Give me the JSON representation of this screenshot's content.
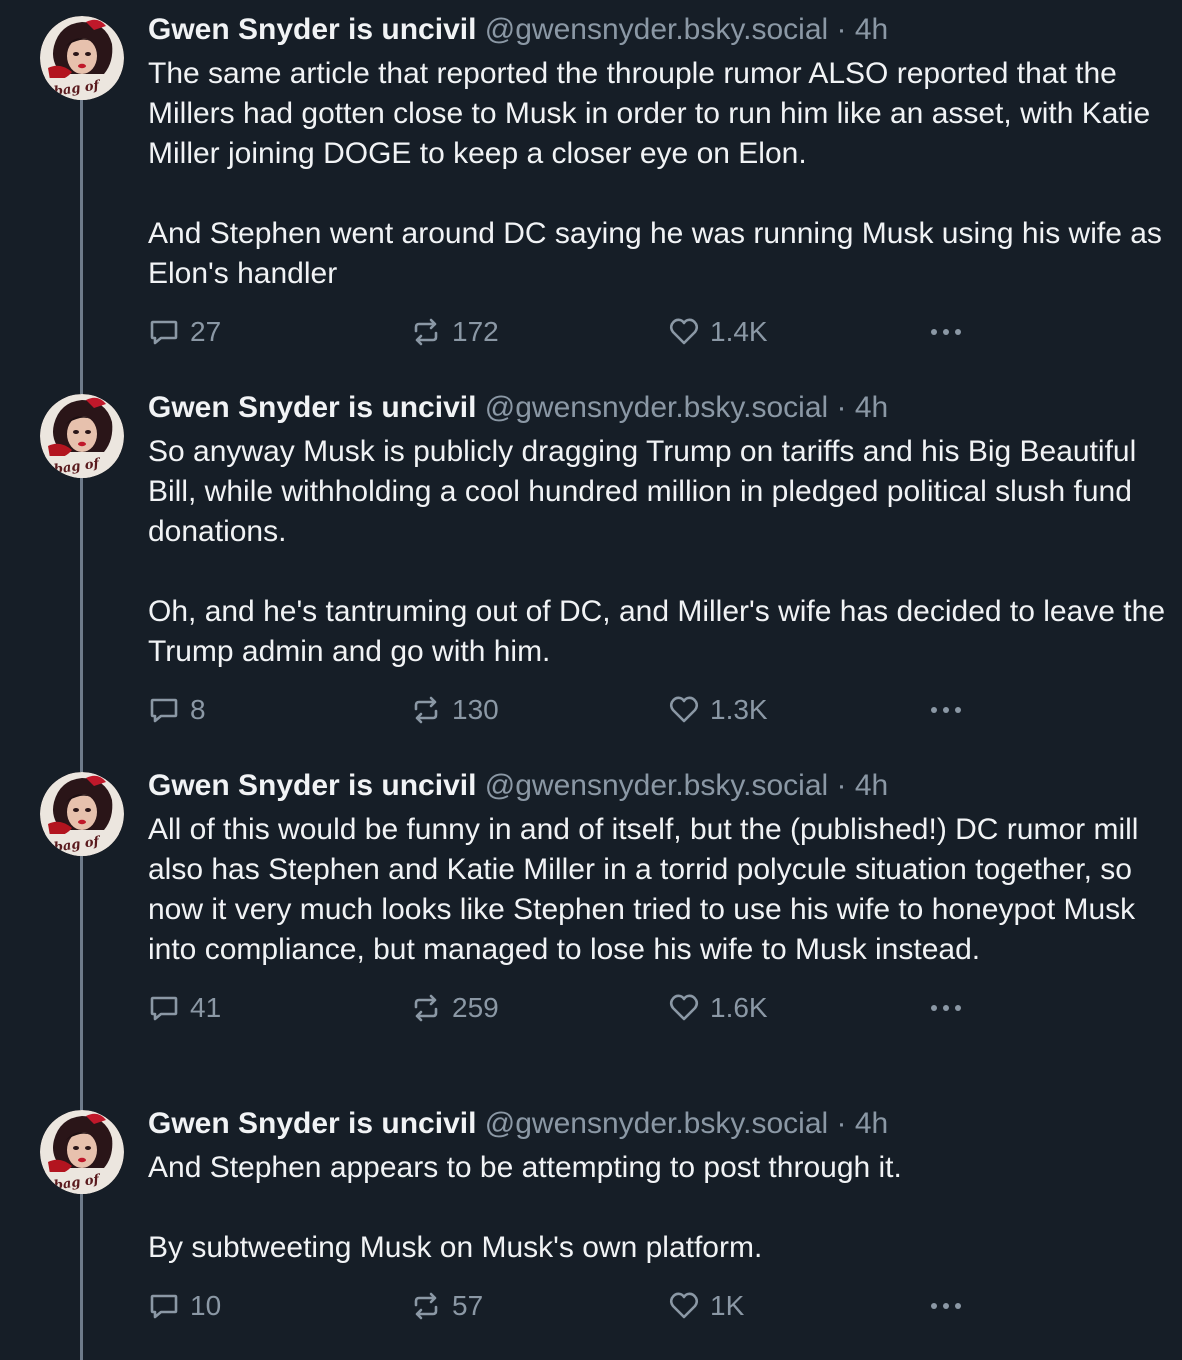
{
  "posts": [
    {
      "author": "Gwen Snyder is uncivil",
      "handle": "@gwensnyder.bsky.social",
      "separator": "·",
      "time": "4h",
      "avatar_text": "bag of",
      "paragraphs": [
        "The same article that reported the throuple rumor ALSO reported that the Millers had gotten close to Musk in order to run him like an asset, with Katie Miller joining DOGE to keep a closer eye on Elon.",
        "And Stephen went around DC saying he was running Musk using his wife as Elon's handler"
      ],
      "replies": "27",
      "reposts": "172",
      "likes": "1.4K"
    },
    {
      "author": "Gwen Snyder is uncivil",
      "handle": "@gwensnyder.bsky.social",
      "separator": "·",
      "time": "4h",
      "avatar_text": "bag of",
      "paragraphs": [
        "So anyway Musk is publicly dragging Trump on tariffs and his Big Beautiful Bill, while withholding a cool hundred million in pledged political slush fund donations.",
        "Oh, and he's tantruming out of DC, and Miller's wife has decided to leave the Trump admin and go with him."
      ],
      "replies": "8",
      "reposts": "130",
      "likes": "1.3K"
    },
    {
      "author": "Gwen Snyder is uncivil",
      "handle": "@gwensnyder.bsky.social",
      "separator": "·",
      "time": "4h",
      "avatar_text": "bag of",
      "paragraphs": [
        "All of this would be funny in and of itself, but the (published!) DC rumor mill also has Stephen and Katie Miller in a torrid polycule situation together, so now it very much looks like Stephen tried to use his wife to honeypot Musk into compliance, but managed to lose his wife to Musk instead."
      ],
      "replies": "41",
      "reposts": "259",
      "likes": "1.6K"
    },
    {
      "author": "Gwen Snyder is uncivil",
      "handle": "@gwensnyder.bsky.social",
      "separator": "·",
      "time": "4h",
      "avatar_text": "bag of",
      "paragraphs": [
        "And Stephen appears to be attempting to post through it.",
        "By subtweeting Musk on Musk's own platform."
      ],
      "replies": "10",
      "reposts": "57",
      "likes": "1K"
    }
  ],
  "colors": {
    "background": "#161e27",
    "text": "#f1f3f5",
    "muted": "#8b98a5",
    "thread_line": "#6e7b8a"
  },
  "icons": [
    "reply-icon",
    "repost-icon",
    "like-icon",
    "more-icon"
  ]
}
